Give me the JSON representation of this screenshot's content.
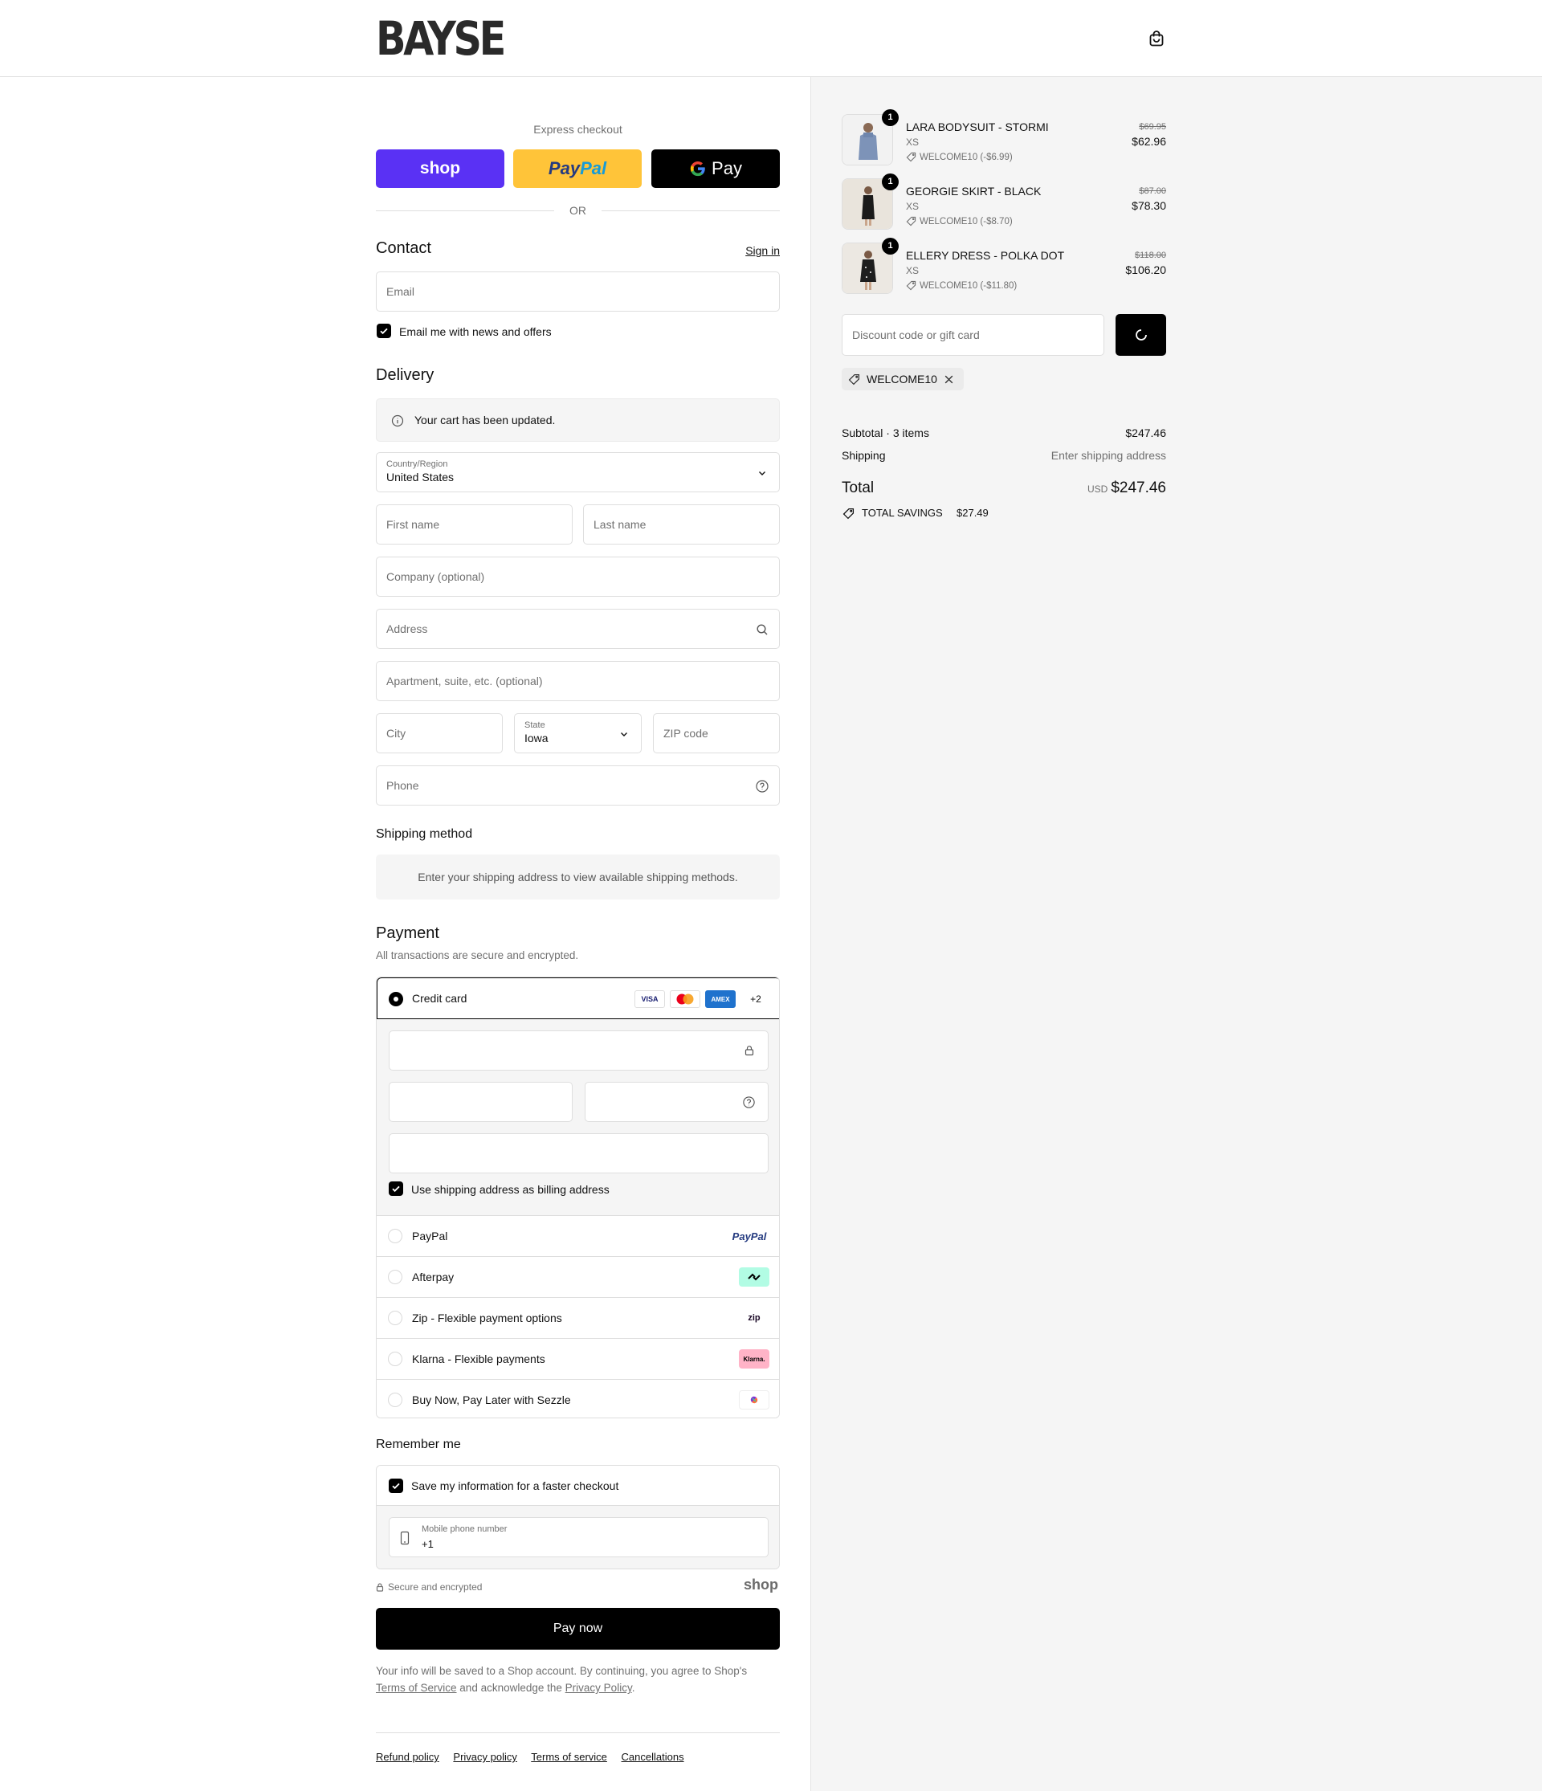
{
  "header": {
    "brand": "BAYSE"
  },
  "express": {
    "title": "Express checkout",
    "shop_label": "shop",
    "paypal_label_a": "Pay",
    "paypal_label_b": "Pal",
    "gpay_label": "Pay",
    "or_label": "OR"
  },
  "contact": {
    "heading": "Contact",
    "sign_in": "Sign in",
    "email_placeholder": "Email",
    "news_label": "Email me with news and offers"
  },
  "delivery": {
    "heading": "Delivery",
    "notice": "Your cart has been updated.",
    "country_label": "Country/Region",
    "country_value": "United States",
    "first_name": "First name",
    "last_name": "Last name",
    "company": "Company (optional)",
    "address": "Address",
    "apartment": "Apartment, suite, etc. (optional)",
    "city": "City",
    "state_label": "State",
    "state_value": "Iowa",
    "zip": "ZIP code",
    "phone": "Phone"
  },
  "shipping": {
    "heading": "Shipping method",
    "message": "Enter your shipping address to view available shipping methods."
  },
  "payment": {
    "heading": "Payment",
    "subtitle": "All transactions are secure and encrypted.",
    "credit_card": "Credit card",
    "card_logos": [
      "VISA",
      "MC",
      "AMEX"
    ],
    "more_cards": "+2",
    "billing_label": "Use shipping address as billing address",
    "methods": [
      {
        "label": "PayPal",
        "badge": "PayPal"
      },
      {
        "label": "Afterpay",
        "badge": ""
      },
      {
        "label": "Zip - Flexible payment options",
        "badge": "zip"
      },
      {
        "label": "Klarna - Flexible payments",
        "badge": "Klarna."
      },
      {
        "label": "Buy Now, Pay Later with Sezzle",
        "badge": ""
      }
    ]
  },
  "remember": {
    "heading": "Remember me",
    "save_label": "Save my information for a faster checkout",
    "mobile_label": "Mobile phone number",
    "mobile_value": "+1"
  },
  "secure": {
    "label": "Secure and encrypted",
    "shop": "shop"
  },
  "pay_now": "Pay now",
  "legal": {
    "line1": "Your info will be saved to a Shop account. By continuing, you agree to Shop's",
    "terms": "Terms of Service",
    "mid": "and acknowledge the",
    "privacy": "Privacy Policy",
    "end": "."
  },
  "footer": {
    "links": [
      "Refund policy",
      "Privacy policy",
      "Terms of service",
      "Cancellations"
    ]
  },
  "cart": {
    "items": [
      {
        "qty": "1",
        "name": "LARA BODYSUIT - STORMI",
        "size": "XS",
        "discount": "WELCOME10 (-$6.99)",
        "old_price": "$69.95",
        "price": "$62.96"
      },
      {
        "qty": "1",
        "name": "GEORGIE SKIRT - BLACK",
        "size": "XS",
        "discount": "WELCOME10 (-$8.70)",
        "old_price": "$87.00",
        "price": "$78.30"
      },
      {
        "qty": "1",
        "name": "ELLERY DRESS - POLKA DOT",
        "size": "XS",
        "discount": "WELCOME10 (-$11.80)",
        "old_price": "$118.00",
        "price": "$106.20"
      }
    ],
    "discount_placeholder": "Discount code or gift card",
    "applied_code": "WELCOME10",
    "subtotal_label": "Subtotal · 3 items",
    "subtotal_value": "$247.46",
    "shipping_label": "Shipping",
    "shipping_value": "Enter shipping address",
    "total_label": "Total",
    "currency": "USD",
    "total_value": "$247.46",
    "savings_label": "TOTAL SAVINGS",
    "savings_value": "$27.49"
  },
  "colors": {
    "shop": "#5a31f4",
    "paypal": "#ffc439",
    "accent": "#000000",
    "sidebar_bg": "#f5f5f5"
  }
}
